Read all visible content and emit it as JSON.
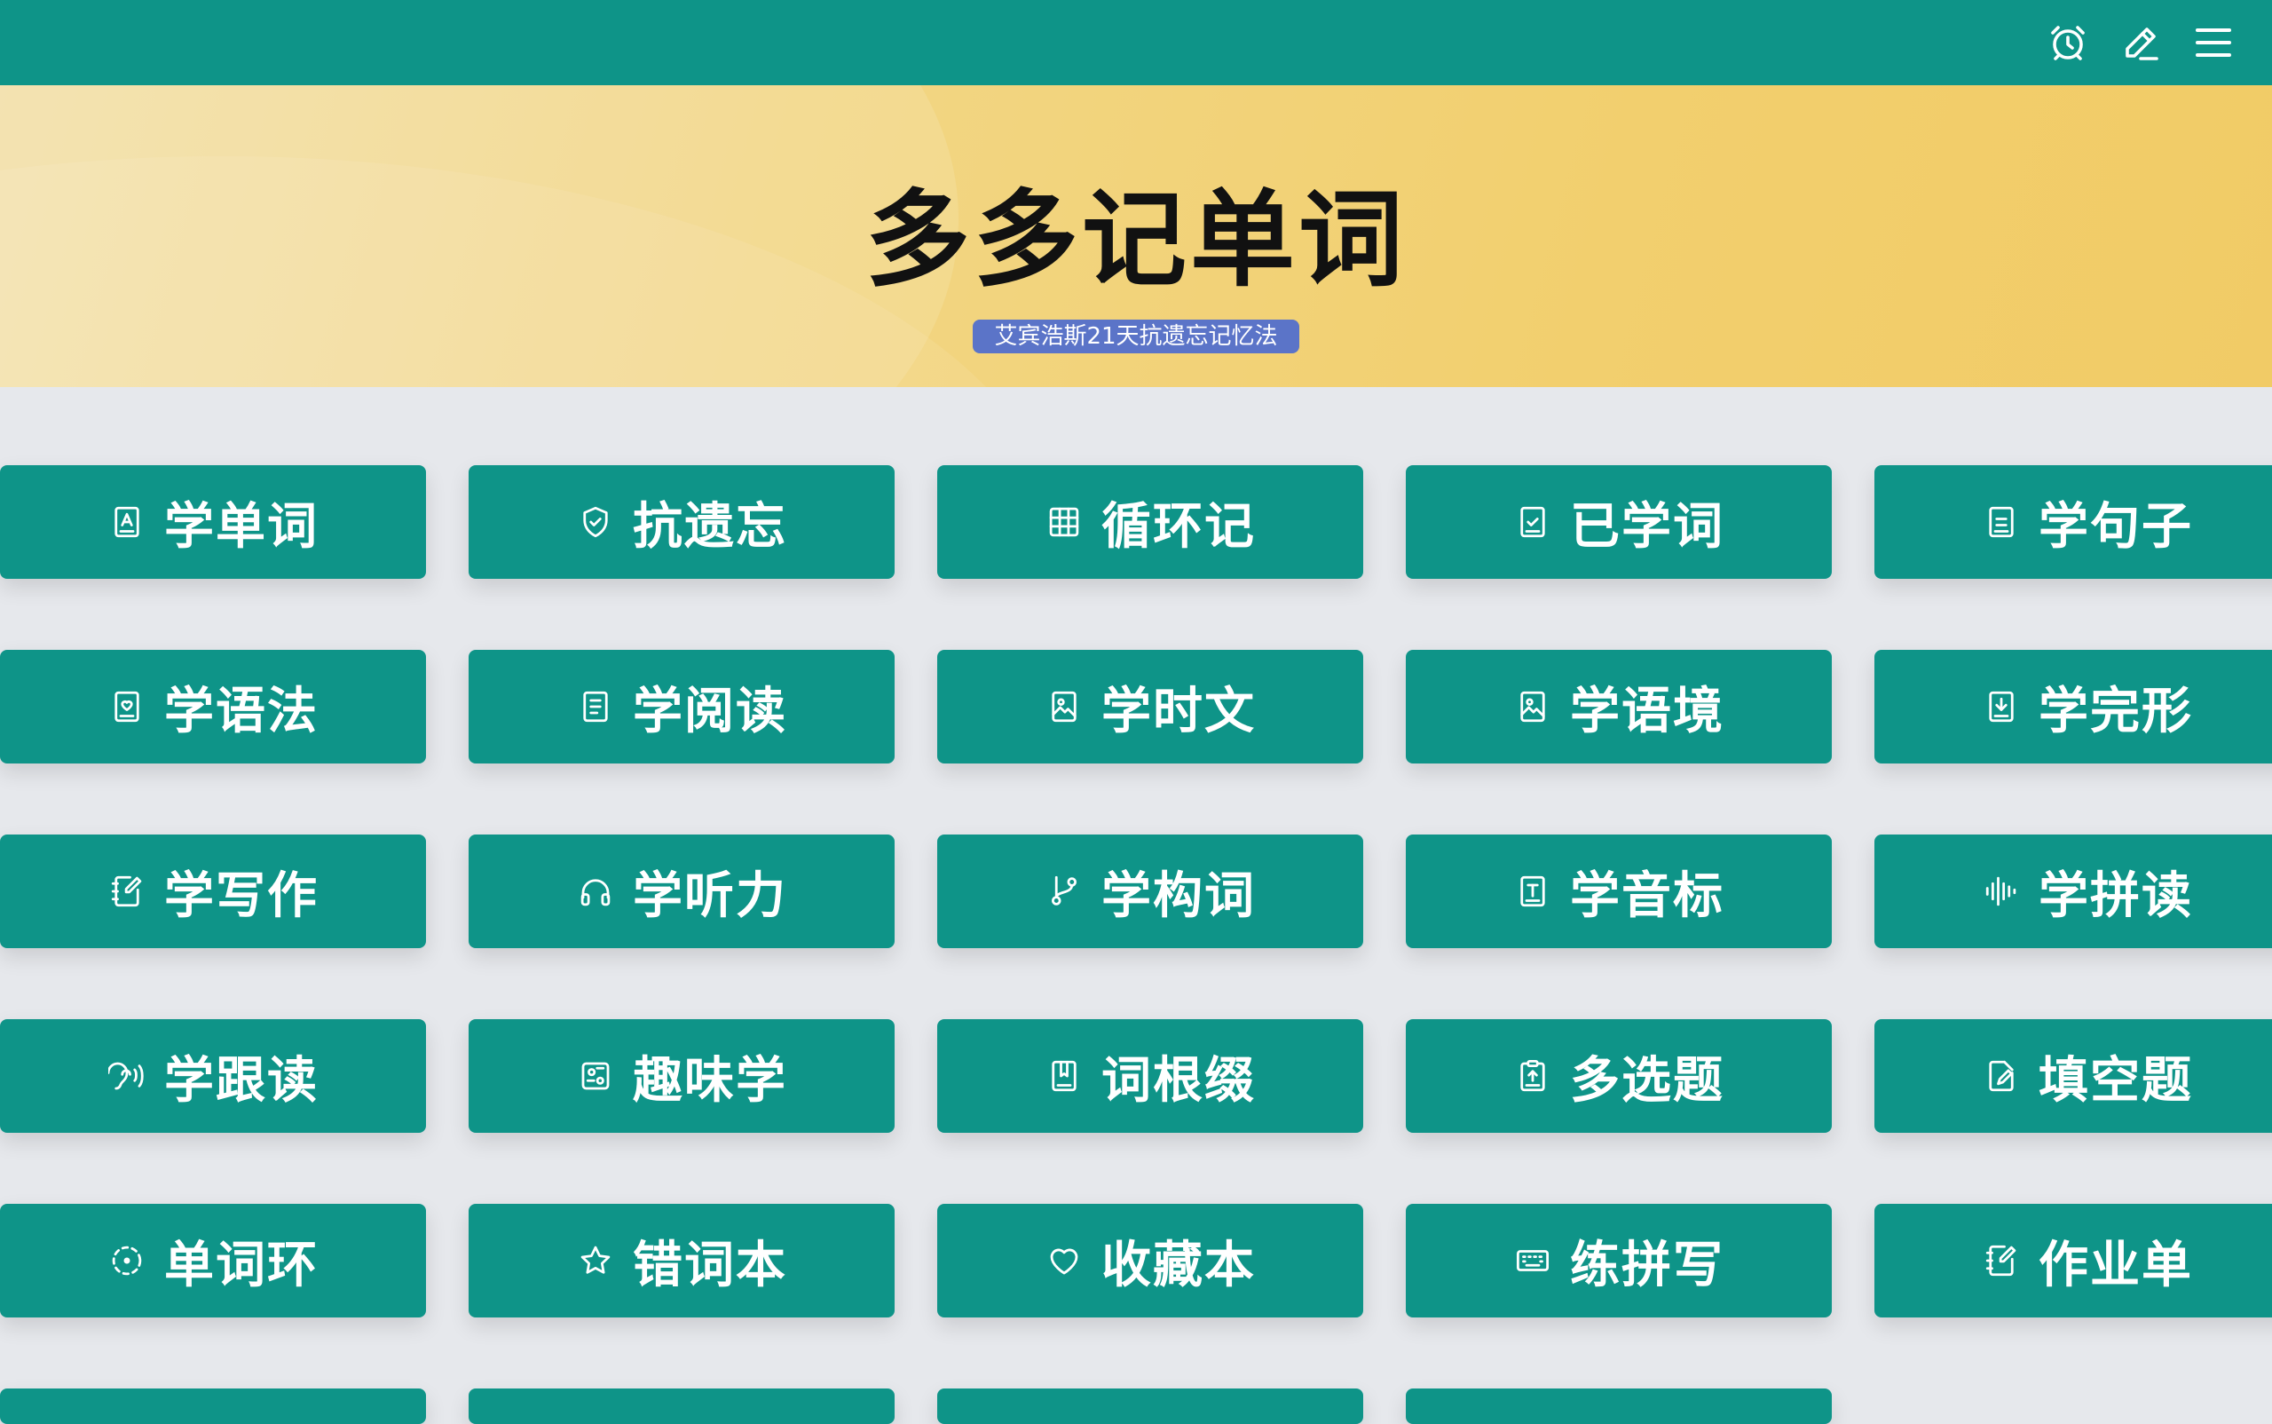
{
  "header": {
    "icons": [
      "alarm-clock-icon",
      "pencil-icon",
      "menu-icon"
    ],
    "bar_color": "#0e9488"
  },
  "hero": {
    "title": "多多记单词",
    "badge": "艾宾浩斯21天抗遗忘记忆法",
    "badge_color": "#5b74c8"
  },
  "tiles": [
    {
      "label": "学单词",
      "icon": "book-letter-icon"
    },
    {
      "label": "抗遗忘",
      "icon": "shield-check-icon"
    },
    {
      "label": "循环记",
      "icon": "grid-icon"
    },
    {
      "label": "已学词",
      "icon": "clipboard-check-icon"
    },
    {
      "label": "学句子",
      "icon": "book-lines-icon"
    },
    {
      "label": "学语法",
      "icon": "book-heart-icon"
    },
    {
      "label": "学阅读",
      "icon": "document-lines-icon"
    },
    {
      "label": "学时文",
      "icon": "image-frame-icon"
    },
    {
      "label": "学语境",
      "icon": "image-frame-icon"
    },
    {
      "label": "学完形",
      "icon": "download-doc-icon"
    },
    {
      "label": "学写作",
      "icon": "notebook-pen-icon"
    },
    {
      "label": "学听力",
      "icon": "headphones-icon"
    },
    {
      "label": "学构词",
      "icon": "branch-icon"
    },
    {
      "label": "学音标",
      "icon": "text-doc-icon"
    },
    {
      "label": "学拼读",
      "icon": "audio-wave-icon"
    },
    {
      "label": "学跟读",
      "icon": "ear-sound-icon"
    },
    {
      "label": "趣味学",
      "icon": "puzzle-board-icon"
    },
    {
      "label": "词根缀",
      "icon": "book-bookmark-icon"
    },
    {
      "label": "多选题",
      "icon": "clipboard-upload-icon"
    },
    {
      "label": "填空题",
      "icon": "doc-edit-icon"
    },
    {
      "label": "单词环",
      "icon": "dashed-circle-icon"
    },
    {
      "label": "错词本",
      "icon": "star-icon"
    },
    {
      "label": "收藏本",
      "icon": "heart-icon"
    },
    {
      "label": "练拼写",
      "icon": "keyboard-icon"
    },
    {
      "label": "作业单",
      "icon": "notebook-pen-icon"
    }
  ],
  "tile_color": "#0e9488"
}
